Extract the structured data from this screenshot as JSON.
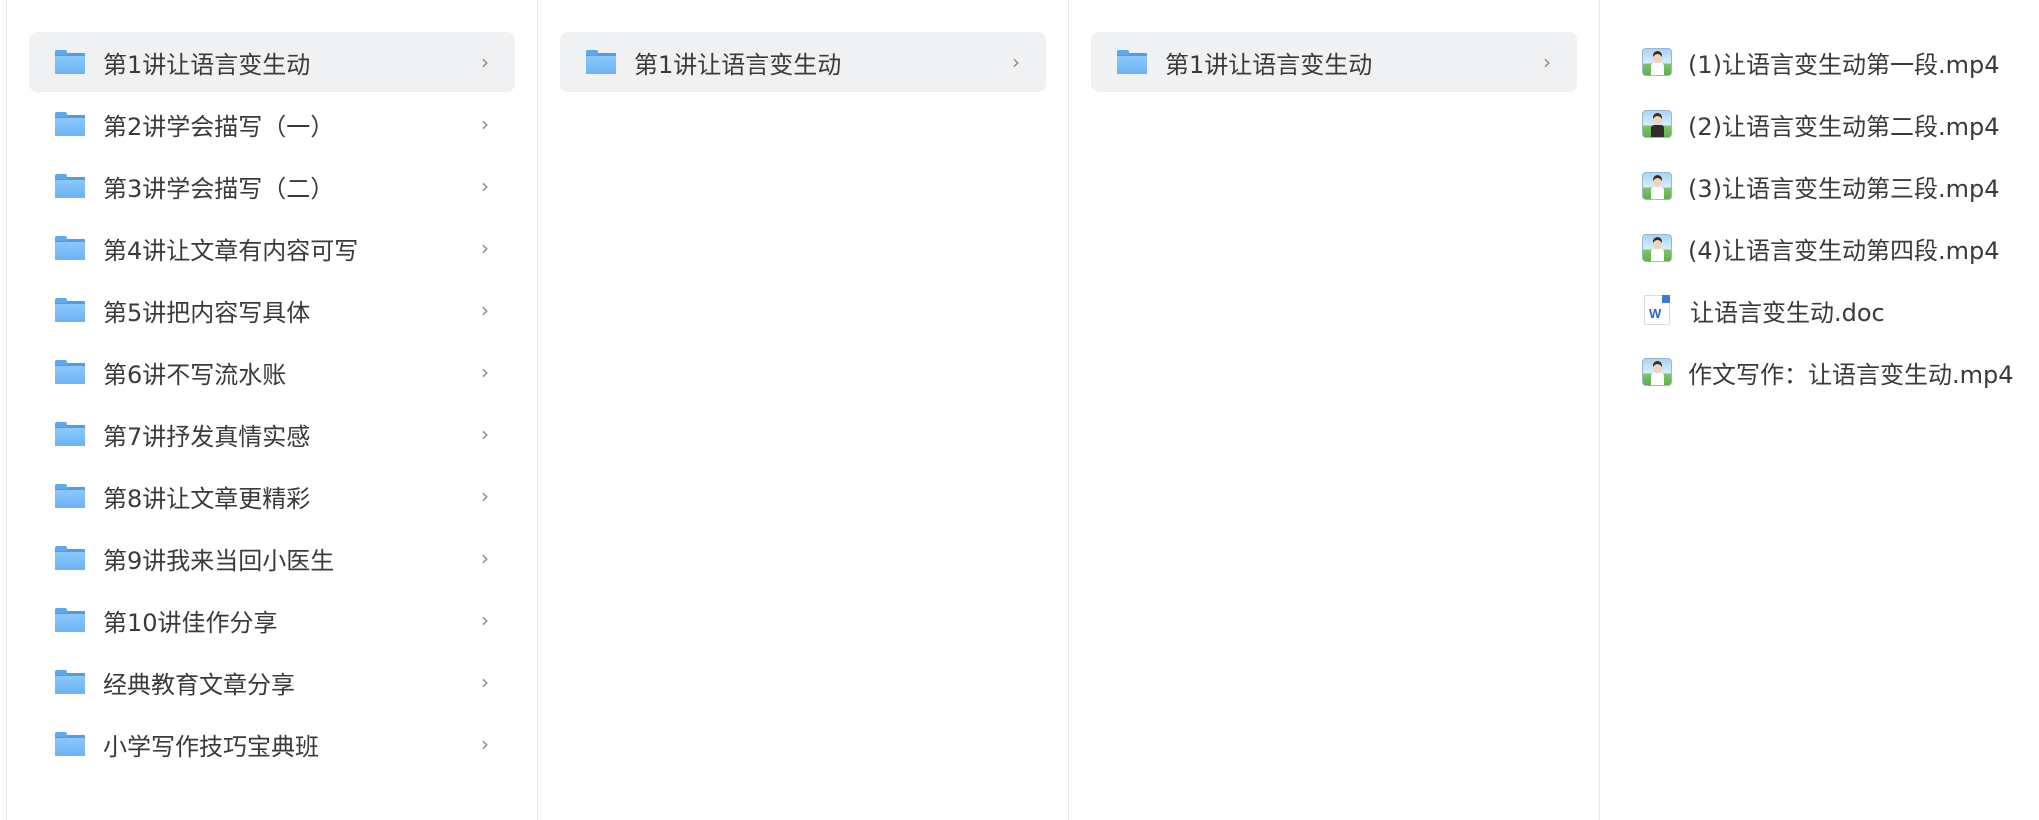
{
  "columns": [
    {
      "items": [
        {
          "label": "第1讲让语言变生动",
          "selected": true
        },
        {
          "label": "第2讲学会描写（一）"
        },
        {
          "label": "第3讲学会描写（二）"
        },
        {
          "label": "第4讲让文章有内容可写"
        },
        {
          "label": "第5讲把内容写具体"
        },
        {
          "label": "第6讲不写流水账"
        },
        {
          "label": "第7讲抒发真情实感"
        },
        {
          "label": "第8讲让文章更精彩"
        },
        {
          "label": "第9讲我来当回小医生"
        },
        {
          "label": "第10讲佳作分享"
        },
        {
          "label": "经典教育文章分享"
        },
        {
          "label": "小学写作技巧宝典班"
        }
      ]
    },
    {
      "items": [
        {
          "label": "第1讲让语言变生动",
          "selected": true
        }
      ]
    },
    {
      "items": [
        {
          "label": "第1讲让语言变生动",
          "selected": true
        }
      ]
    }
  ],
  "files": [
    {
      "name": "(1)让语言变生动第一段.mp4",
      "icon": "video-thumbnail-icon"
    },
    {
      "name": "(2)让语言变生动第二段.mp4",
      "icon": "video-thumbnail-icon"
    },
    {
      "name": "(3)让语言变生动第三段.mp4",
      "icon": "video-thumbnail-icon"
    },
    {
      "name": "(4)让语言变生动第四段.mp4",
      "icon": "video-thumbnail-icon"
    },
    {
      "name": "让语言变生动.doc",
      "icon": "word-doc-icon"
    },
    {
      "name": "作文写作：让语言变生动.mp4",
      "icon": "video-thumbnail-icon"
    }
  ],
  "chevron": "›",
  "doc_icon_letter": "W"
}
